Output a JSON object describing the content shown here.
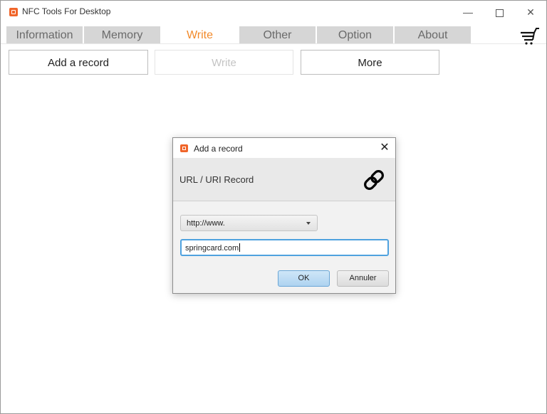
{
  "window": {
    "title": "NFC Tools For Desktop",
    "controls": {
      "minimize": "—",
      "close": "✕"
    }
  },
  "tabs": [
    {
      "label": "Information",
      "active": false
    },
    {
      "label": "Memory",
      "active": false
    },
    {
      "label": "Write",
      "active": true
    },
    {
      "label": "Other",
      "active": false
    },
    {
      "label": "Option",
      "active": false
    },
    {
      "label": "About",
      "active": false
    }
  ],
  "toolbar": {
    "add_record": "Add a record",
    "write": "Write",
    "more": "More",
    "cart_icon": "cart-icon"
  },
  "dialog": {
    "title": "Add a record",
    "close": "✕",
    "header": "URL / URI Record",
    "header_icon": "link-icon",
    "prefix_select": {
      "selected": "http://www."
    },
    "url_input": {
      "value": "springcard.com"
    },
    "ok_label": "OK",
    "cancel_label": "Annuler"
  },
  "colors": {
    "accent": "#f28a2a",
    "app_icon": "#f0652a",
    "focus": "#4fa2df"
  }
}
